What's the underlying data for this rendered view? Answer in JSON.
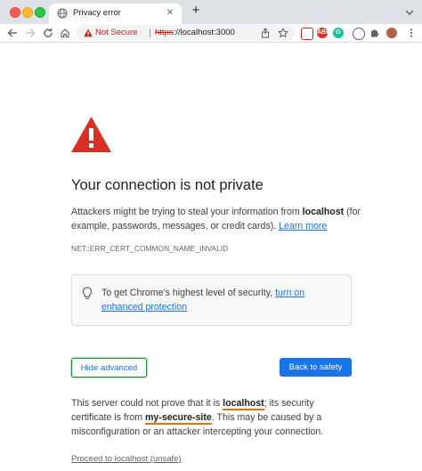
{
  "browser": {
    "tab": {
      "title": "Privacy error"
    },
    "omnibox": {
      "security_label": "Not Secure",
      "url_scheme": "https",
      "url_rest": "://localhost:3000"
    },
    "extensions": [
      "ABP",
      "G"
    ]
  },
  "page": {
    "heading": "Your connection is not private",
    "intro_before": "Attackers might be trying to steal your information from ",
    "intro_host": "localhost",
    "intro_after": " (for example, passwords, messages, or credit cards). ",
    "learn_more": "Learn more",
    "error_code": "NET::ERR_CERT_COMMON_NAME_INVALID",
    "callout_text": "To get Chrome’s highest level of security, ",
    "callout_link": "turn on enhanced protection",
    "hide_advanced": "Hide advanced",
    "back_to_safety": "Back to safety",
    "detail_1": "This server could not prove that it is ",
    "detail_host": "localhost",
    "detail_2": "; its security certificate is from ",
    "detail_issuer": "my-secure-site",
    "detail_3": ". This may be caused by a misconfiguration or an attacker intercepting your connection.",
    "proceed_link": "Proceed to localhost (unsafe)"
  },
  "colors": {
    "primary": "#1a73e8",
    "danger": "#d93025",
    "highlight_underline": "#e37400",
    "focus_outline": "#1e8e3e"
  }
}
